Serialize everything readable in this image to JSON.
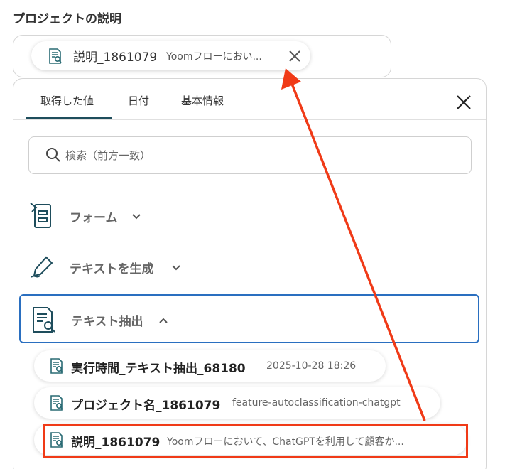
{
  "section_title": "プロジェクトの説明",
  "field_chip": {
    "name": "説明_1861079",
    "preview": "Yoomフローにおい..."
  },
  "tabs": [
    {
      "label": "取得した値",
      "active": true
    },
    {
      "label": "日付",
      "active": false
    },
    {
      "label": "基本情報",
      "active": false
    }
  ],
  "search": {
    "placeholder": "検索（前方一致）"
  },
  "groups": [
    {
      "label": "フォーム",
      "icon": "form-icon",
      "expanded": false
    },
    {
      "label": "テキストを生成",
      "icon": "pen-icon",
      "expanded": false
    },
    {
      "label": "テキスト抽出",
      "icon": "document-search-icon",
      "expanded": true
    }
  ],
  "items": [
    {
      "name": "実行時間_テキスト抽出_68180",
      "value": "2025-10-28 18:26"
    },
    {
      "name": "プロジェクト名_1861079",
      "value": "feature-autoclassification-chatgpt"
    },
    {
      "name": "説明_1861079",
      "value": "Yoomフローにおいて、ChatGPTを利用して顧客か..."
    }
  ],
  "colors": {
    "accent": "#1e4d5c",
    "focus_border": "#2a6fc0",
    "annotation": "#f03a17"
  }
}
